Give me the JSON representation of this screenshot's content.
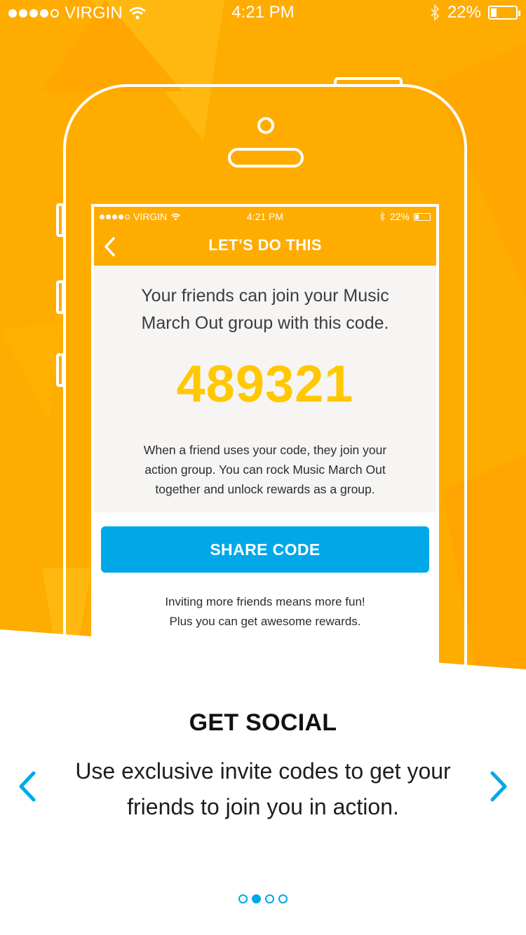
{
  "status_bar": {
    "carrier": "VIRGIN",
    "time": "4:21 PM",
    "battery": "22%"
  },
  "mockup": {
    "status_bar": {
      "carrier": "VIRGIN",
      "time": "4:21 PM",
      "battery": "22%"
    },
    "nav_title": "LET’S DO THIS",
    "intro_line1": "Your friends can join your Music",
    "intro_line2": "March Out group with this code.",
    "code": "489321",
    "explain_line1": "When a friend uses your code, they join your",
    "explain_line2": "action group. You can rock Music March Out",
    "explain_line3": "together and unlock rewards as a group.",
    "share_button": "SHARE CODE",
    "invite_line1": "Inviting more friends means more fun!",
    "invite_line2": "Plus you can get awesome rewards."
  },
  "onboarding": {
    "title": "GET SOCIAL",
    "description_line1": "Use exclusive invite codes to get your",
    "description_line2": "friends to join you in action.",
    "page_count": 4,
    "active_page": 2
  },
  "colors": {
    "brand_orange": "#ffac00",
    "accent_blue": "#00a8e8",
    "code_yellow": "#ffc800"
  }
}
